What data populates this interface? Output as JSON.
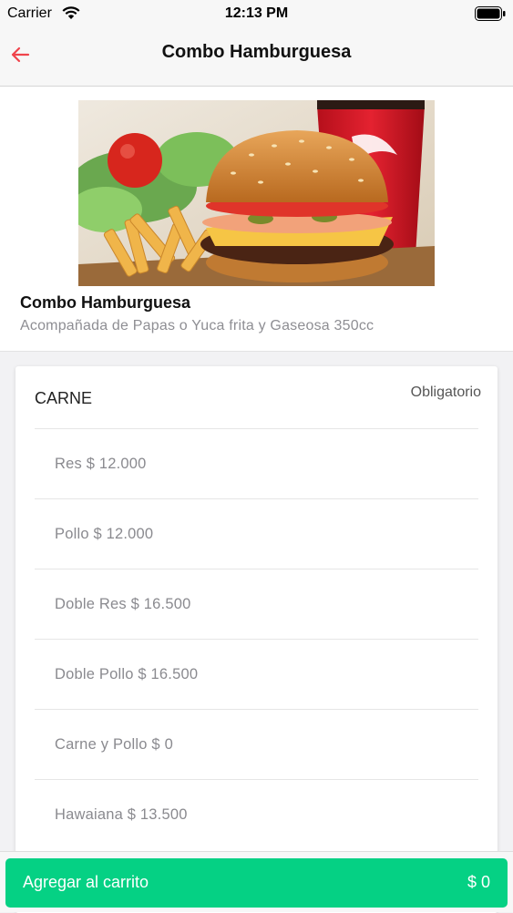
{
  "status_bar": {
    "carrier": "Carrier",
    "time": "12:13 PM"
  },
  "nav": {
    "title": "Combo Hamburguesa",
    "back_icon": "arrow-left-icon",
    "accent_color": "#f0444c"
  },
  "product": {
    "name": "Combo Hamburguesa",
    "description": "Acompañada de Papas o Yuca frita y Gaseosa 350cc"
  },
  "options_group": {
    "title": "CARNE",
    "required_label": "Obligatorio",
    "items": [
      {
        "label": "Res $ 12.000"
      },
      {
        "label": "Pollo $ 12.000"
      },
      {
        "label": "Doble Res $ 16.500"
      },
      {
        "label": "Doble Pollo $ 16.500"
      },
      {
        "label": "Carne y Pollo $ 0"
      },
      {
        "label": "Hawaiana $ 13.500"
      }
    ]
  },
  "cart": {
    "label": "Agregar al carrito",
    "total": "$ 0",
    "button_color": "#05d184"
  }
}
